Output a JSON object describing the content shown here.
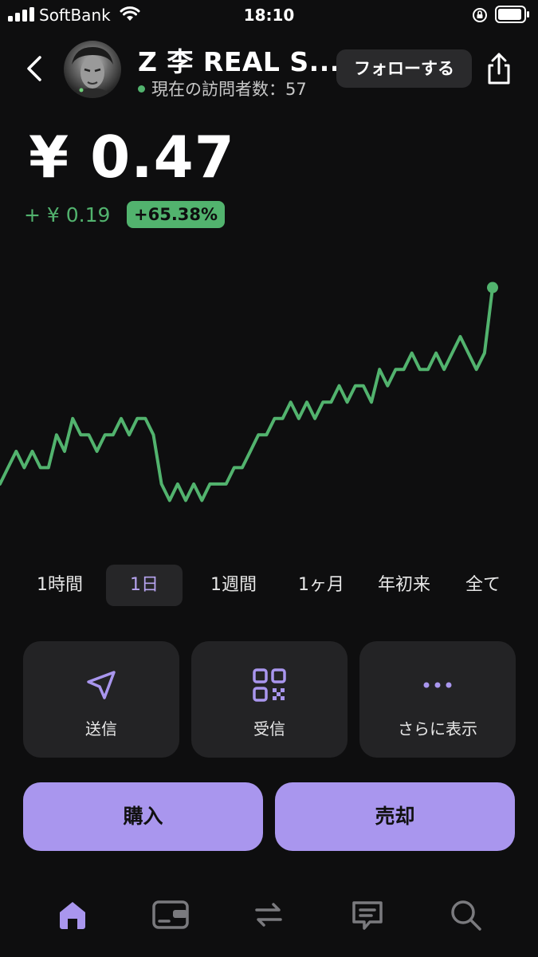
{
  "status_bar": {
    "carrier": "SoftBank",
    "time": "18:10"
  },
  "header": {
    "title": "Z 李 REAL S...",
    "visitors": "現在の訪問者数：57",
    "follow_label": "フォローする"
  },
  "price": {
    "value": "¥ 0.47",
    "change": "+ ¥ 0.19",
    "change_pct": "+65.38%"
  },
  "chart_data": {
    "type": "line",
    "series": [
      {
        "values": [
          0.35,
          0.36,
          0.37,
          0.36,
          0.37,
          0.36,
          0.36,
          0.38,
          0.37,
          0.39,
          0.38,
          0.38,
          0.37,
          0.38,
          0.38,
          0.39,
          0.38,
          0.39,
          0.39,
          0.38,
          0.35,
          0.34,
          0.35,
          0.34,
          0.35,
          0.34,
          0.35,
          0.35,
          0.35,
          0.36,
          0.36,
          0.37,
          0.38,
          0.38,
          0.39,
          0.39,
          0.4,
          0.39,
          0.4,
          0.39,
          0.4,
          0.4,
          0.41,
          0.4,
          0.41,
          0.41,
          0.4,
          0.42,
          0.41,
          0.42,
          0.42,
          0.43,
          0.42,
          0.42,
          0.43,
          0.42,
          0.43,
          0.44,
          0.43,
          0.42,
          0.43,
          0.47
        ]
      }
    ],
    "colors": {
      "line": "#52b36e"
    }
  },
  "timeframes": [
    "1時間",
    "1日",
    "1週間",
    "1ヶ月",
    "年初来",
    "全て"
  ],
  "actions": {
    "send": {
      "label": "送信",
      "icon": "send-icon"
    },
    "receive": {
      "label": "受信",
      "icon": "qr-code-icon"
    },
    "more": {
      "label": "さらに表示",
      "icon": "more-icon"
    }
  },
  "trade": {
    "buy_label": "購入",
    "sell_label": "売却"
  },
  "nav": [
    "home-icon",
    "wallet-icon",
    "swap-icon",
    "chat-icon",
    "search-icon"
  ],
  "colors": {
    "accent": "#a996ee",
    "positive": "#52b36e",
    "background": "#0e0e0f"
  }
}
